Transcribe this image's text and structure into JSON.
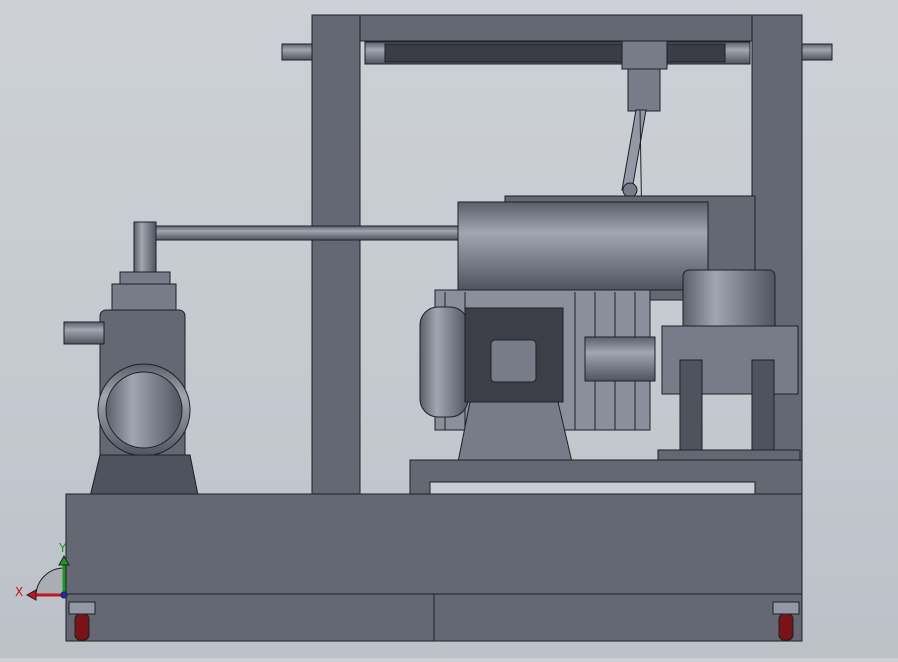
{
  "viewport": {
    "triad": {
      "x_label": "X",
      "y_label": "Y"
    }
  },
  "colors": {
    "background": "#c8cdd4",
    "part": "#646873",
    "x_axis": "#c0161c",
    "y_axis": "#1a9a1a",
    "z_axis": "#1a2ad0",
    "wheel": "#7a1216"
  }
}
